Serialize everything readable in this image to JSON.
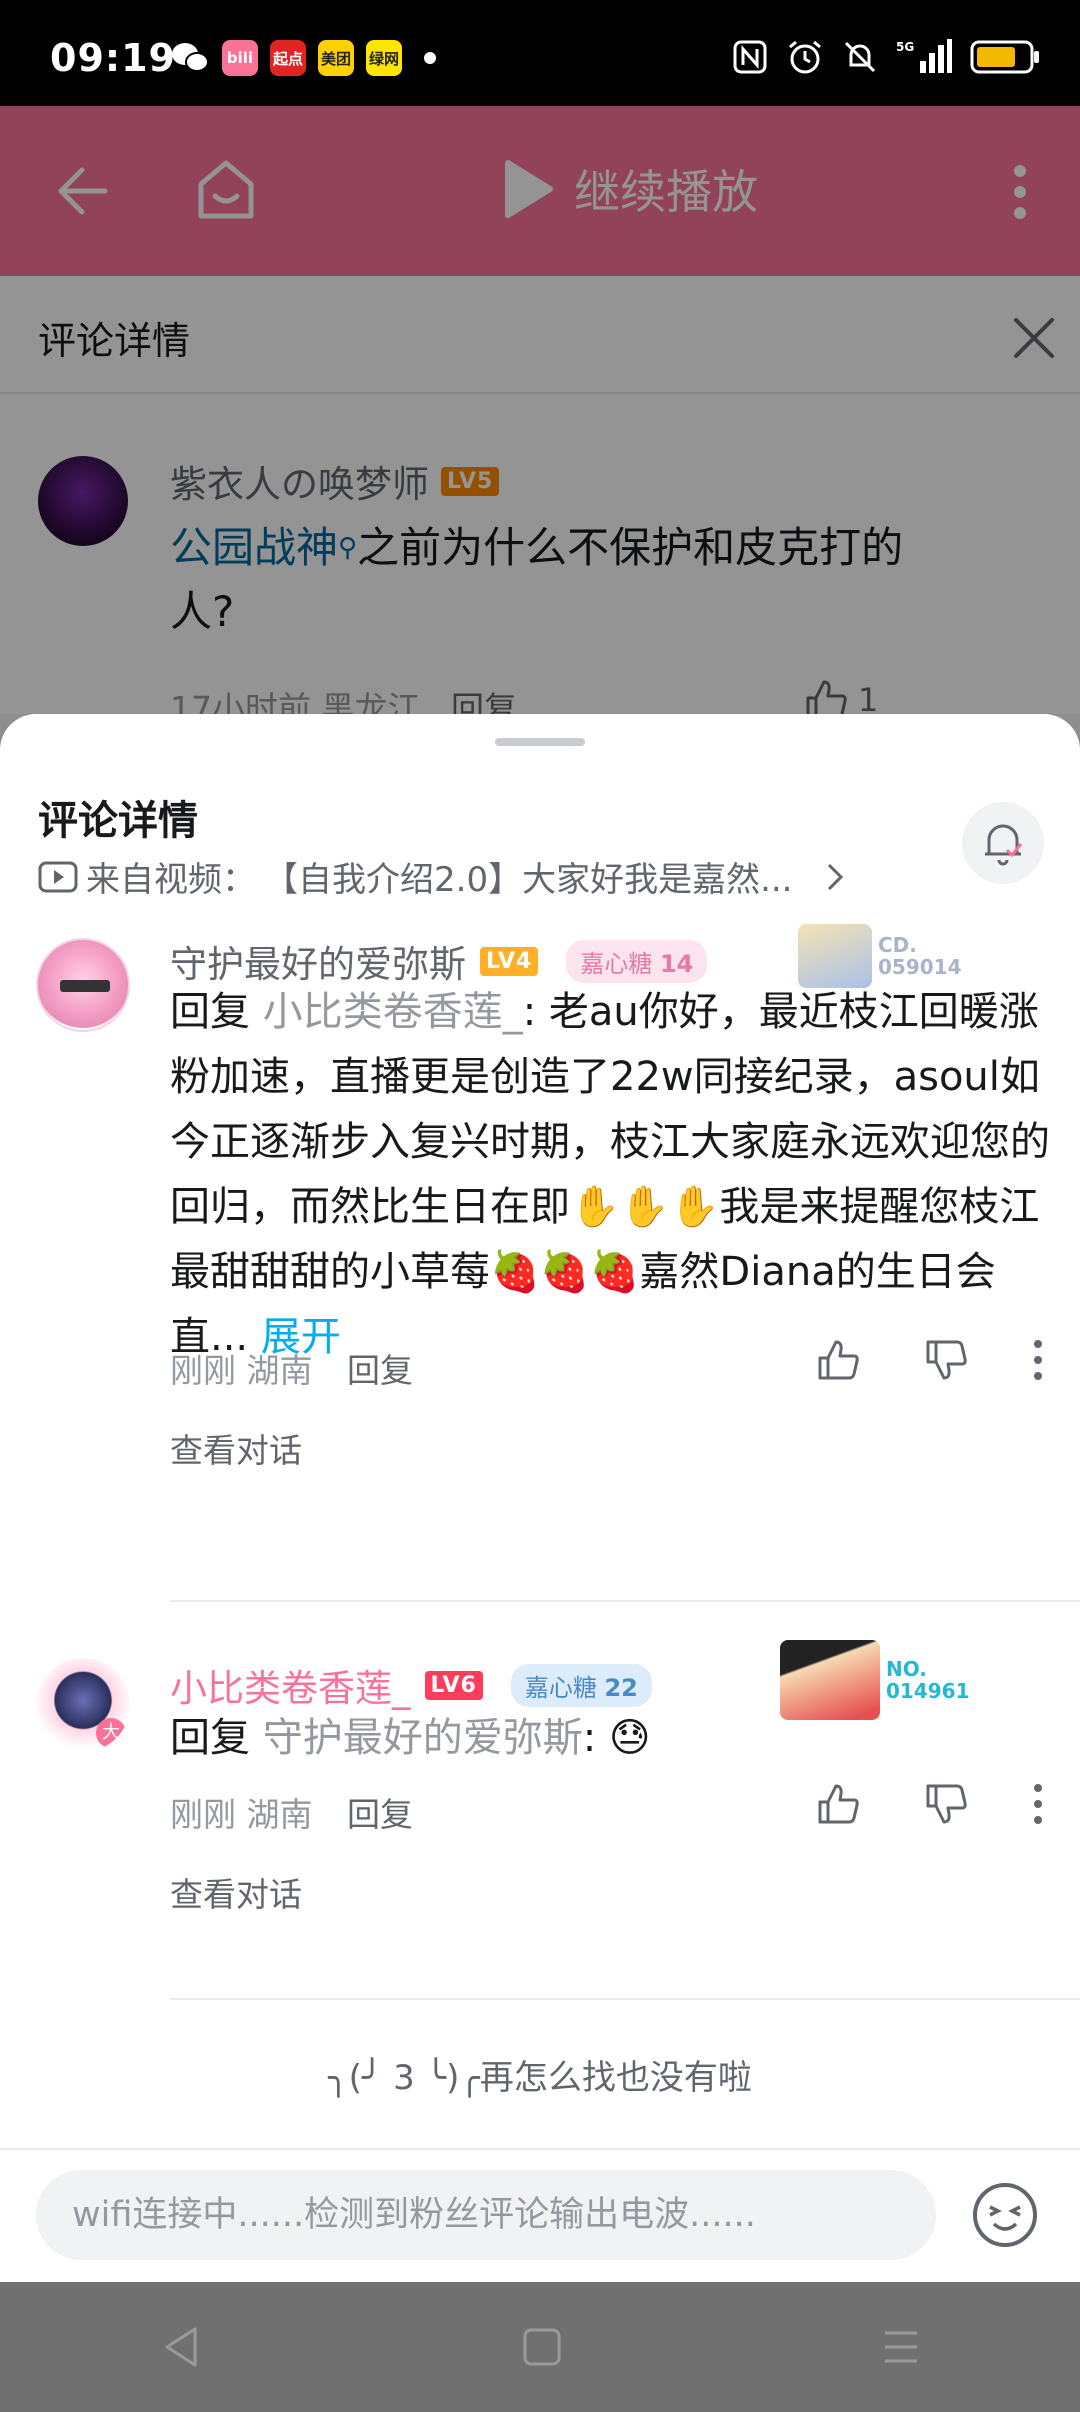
{
  "status_bar": {
    "time": "09:19",
    "apps": [
      {
        "name": "wechat-icon"
      },
      {
        "label": "bili",
        "color": "#fb7299"
      },
      {
        "label": "起点",
        "color": "#e02424"
      },
      {
        "label": "美团",
        "color": "#ffd100"
      },
      {
        "label": "绿网",
        "color": "#ffe600"
      }
    ],
    "network": "5G",
    "battery_level": 0.75,
    "battery_color": "#f5b800"
  },
  "background": {
    "continue_label": "继续播放",
    "detail_title": "评论详情",
    "comment": {
      "username": "紫衣人の唤梦师",
      "level": "LV5",
      "link": "公园战神",
      "text_line1": "之前为什么不保护和皮克打的",
      "text_line2": "人?",
      "meta": "17小时前 黑龙江",
      "reply": "回复",
      "likes": "1"
    }
  },
  "sheet": {
    "title": "评论详情",
    "source_prefix": "来自视频：",
    "source_title": "【自我介绍2.0】大家好我是嘉然...",
    "comments": [
      {
        "username": "守护最好的爱弥斯",
        "username_color": "#61666d",
        "level": "LV4",
        "level_color": "#ffb027",
        "fan_badge": "嘉心糖",
        "fan_level": "14",
        "fan_color": "#e47aa8",
        "fan_bg": "#fbe4ee",
        "card_no_line1": "CD.",
        "card_no_line2": "059014",
        "card_color": "#a9b3c9",
        "reply_prefix": "回复 ",
        "reply_to": "小比类卷香莲_",
        "text": ": 老au你好，最近枝江回暖涨粉加速，直播更是创造了22w同接纪录，asoul如今正逐渐步入复兴时期，枝江大家庭永远欢迎您的回归，而然比生日在即✋✋✋我是来提醒您枝江最甜甜甜的小草莓🍓🍓🍓嘉然Diana的生日会直...",
        "expand": "展开",
        "time": "刚刚",
        "location": "湖南",
        "reply_label": "回复",
        "view_conversation": "查看对话"
      },
      {
        "username": "小比类卷香莲_",
        "username_color": "#fb7299",
        "level": "LV6",
        "level_color": "#ff5c7c",
        "fan_badge": "嘉心糖",
        "fan_level": "22",
        "fan_color": "#4a89c8",
        "fan_bg": "#dcecfb",
        "card_no_line1": "NO.",
        "card_no_line2": "014961",
        "card_color": "#24b8d6",
        "reply_prefix": "回复 ",
        "reply_to": "守护最好的爱弥斯",
        "text": ": 😓",
        "time": "刚刚",
        "location": "湖南",
        "reply_label": "回复",
        "view_conversation": "查看对话"
      }
    ],
    "end_text": "╮(╯ 3 ╰)╭再怎么找也没有啦",
    "input_placeholder": "wifi连接中......检测到粉丝评论输出电波......"
  }
}
